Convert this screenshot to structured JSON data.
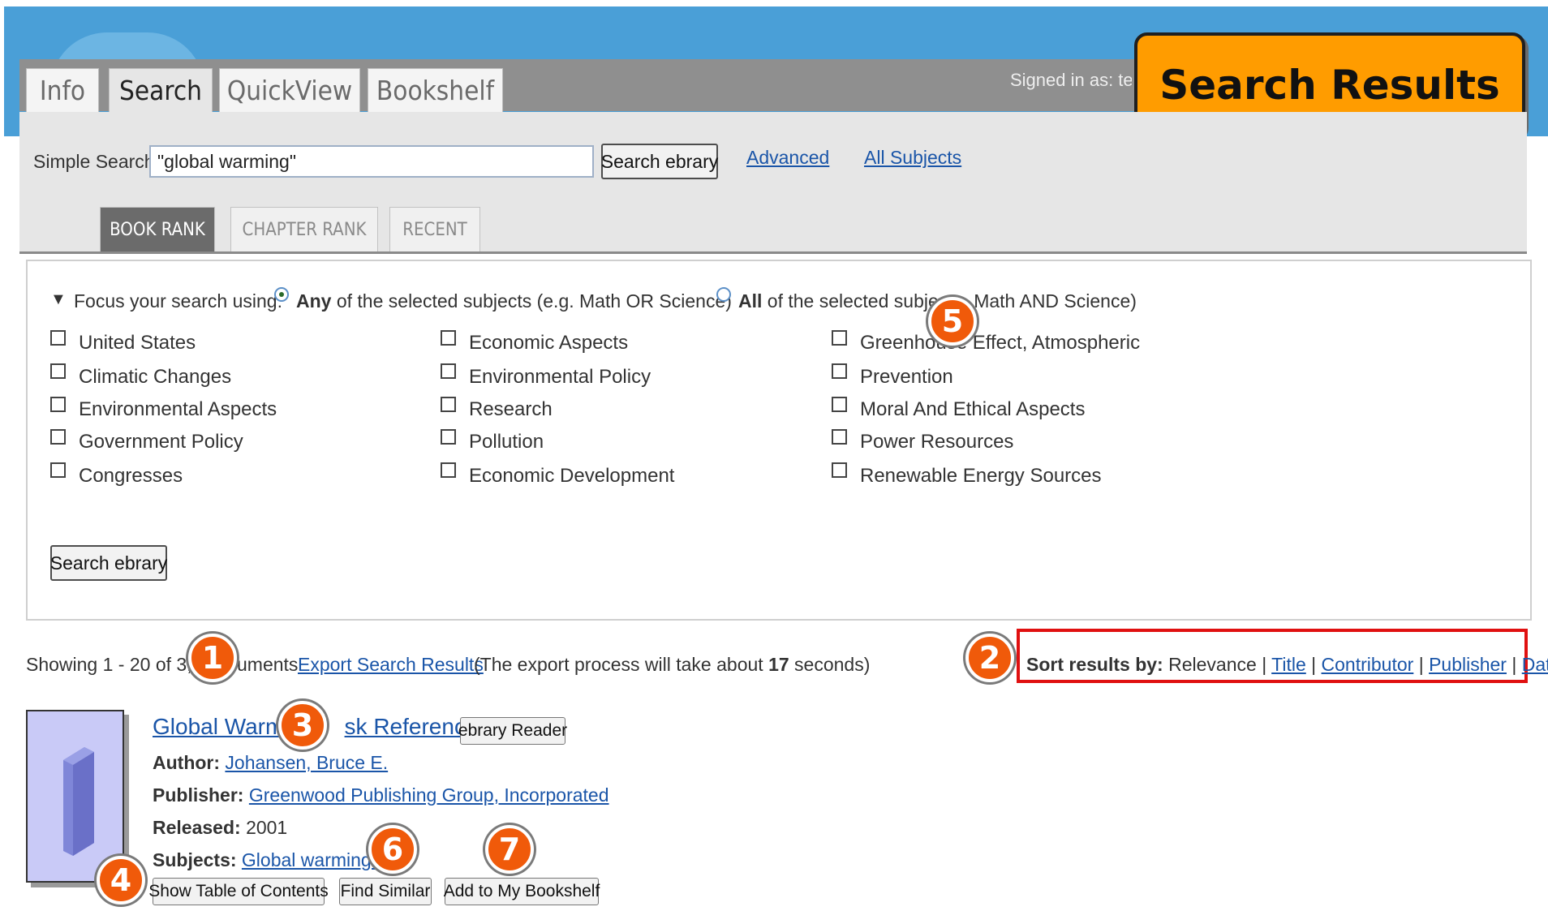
{
  "nav": {
    "tabs": [
      "Info",
      "Search",
      "QuickView",
      "Bookshelf"
    ],
    "signed_in": "Signed in as: ter",
    "callout_title": "Search Results"
  },
  "search": {
    "label": "Simple Search:",
    "value": "\"global warming\"",
    "button": "Search ebrary",
    "advanced": "Advanced",
    "all_subjects": "All Subjects"
  },
  "rank_tabs": [
    "BOOK RANK",
    "CHAPTER RANK",
    "RECENT"
  ],
  "focus": {
    "arrow": "▼",
    "label": "Focus your search using:",
    "any_bold": "Any",
    "any_rest": "of the selected subjects (e.g. Math OR Science)",
    "all_bold": "All",
    "all_rest": "of the selected subjec  g. Math AND Science)",
    "subjects": {
      "col1": [
        "United States",
        "Climatic Changes",
        "Environmental Aspects",
        "Government Policy",
        "Congresses"
      ],
      "col2": [
        "Economic Aspects",
        "Environmental Policy",
        "Research",
        "Pollution",
        "Economic Development"
      ],
      "col3": [
        "Greenhouse Effect, Atmospheric",
        "Prevention",
        "Moral And Ethical Aspects",
        "Power Resources",
        "Renewable Energy Sources"
      ]
    },
    "button": "Search ebrary"
  },
  "results": {
    "showing": "Showing 1 - 20 of 3,62",
    "showing_tail": "uments",
    "export_link": "Export Search Results",
    "export_note_pre": "(The export process will take about",
    "export_seconds": "17",
    "export_note_post": "seconds)",
    "sort_label": "Sort results by:",
    "sort_current": "Relevance",
    "sort_links": [
      "Title",
      "Contributor",
      "Publisher",
      "Date"
    ],
    "sep": "|"
  },
  "book": {
    "title_a": "Global Warmi",
    "title_b": "sk Reference",
    "reader_button": "ebrary Reader",
    "author_label": "Author:",
    "author": "Johansen, Bruce E.",
    "publisher_label": "Publisher:",
    "publisher": "Greenwood Publishing Group, Incorporated",
    "released_label": "Released:",
    "released": "2001",
    "subjects_label": "Subjects:",
    "subject": "Global warming.",
    "toc_button": "Show Table of Contents",
    "similar_button": "Find Similar",
    "bookshelf_button": "Add to My Bookshelf"
  },
  "badges": [
    "1",
    "2",
    "3",
    "4",
    "5",
    "6",
    "7"
  ],
  "colors": {
    "header_blue": "#4a9fd7",
    "callout_orange": "#ff9c00",
    "badge_orange": "#f05a0a",
    "sort_highlight": "#e01010",
    "link": "#1a55a8"
  }
}
